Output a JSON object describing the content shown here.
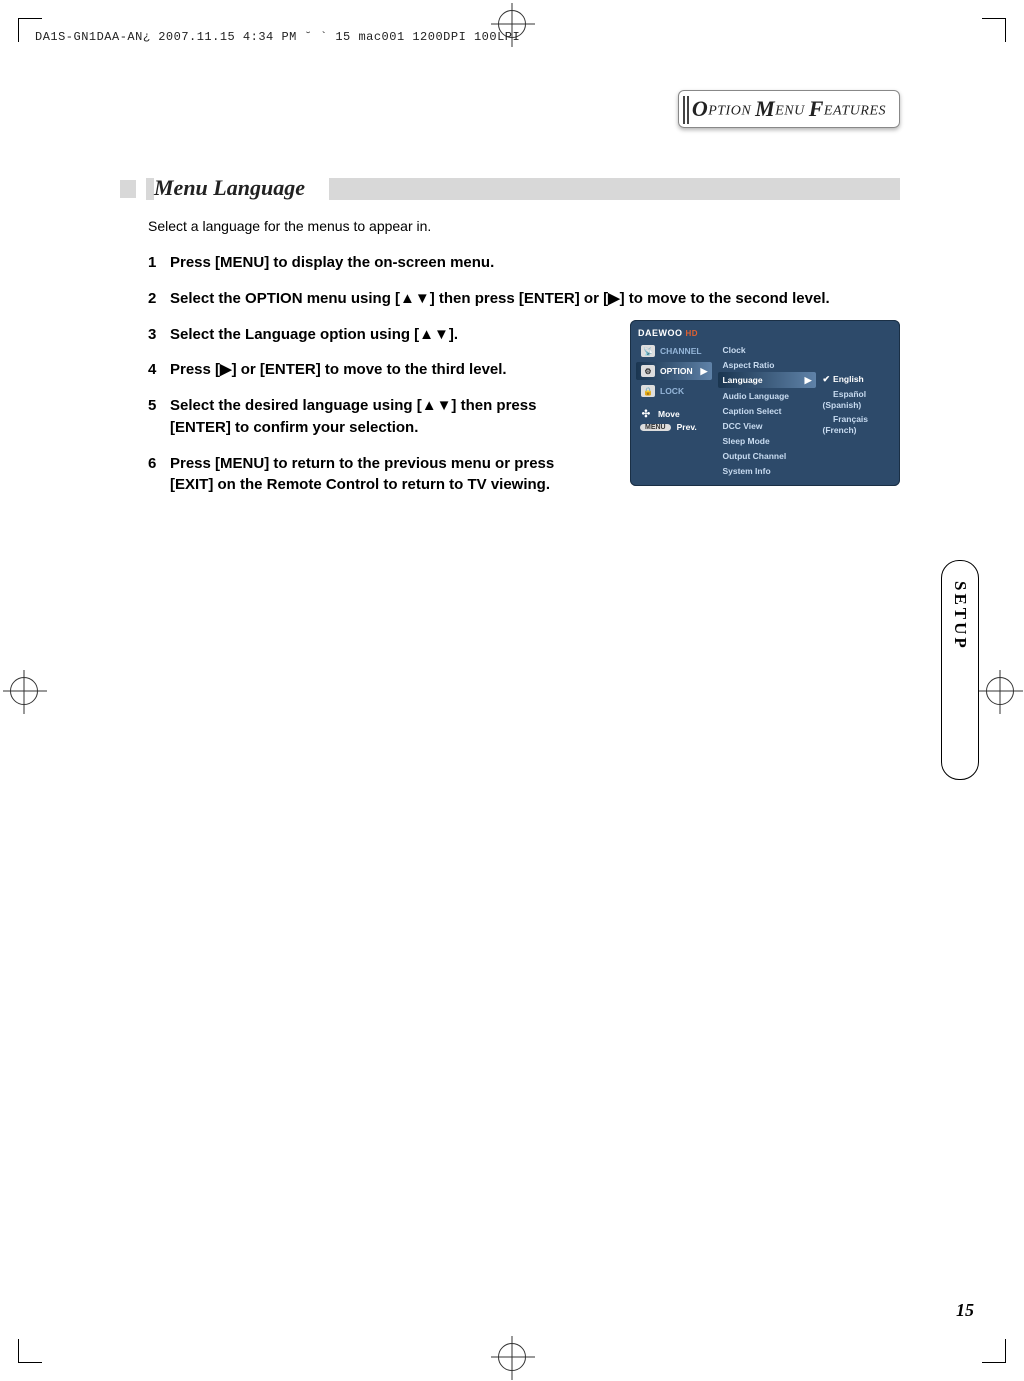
{
  "top_header": "DA1S-GN1DAA-AN¿  2007.11.15 4:34 PM  ˘ ` 15   mac001  1200DPI 100LPI",
  "header": {
    "text_parts": [
      "O",
      "PTION ",
      "M",
      "ENU ",
      "F",
      "EATURES"
    ]
  },
  "section": {
    "title": "Menu Language",
    "intro": "Select a language for the menus to appear in."
  },
  "steps": [
    {
      "n": "1",
      "text": "Press [MENU] to display the on-screen menu."
    },
    {
      "n": "2",
      "text": "Select the OPTION menu using [▲▼] then press [ENTER] or [▶] to move to the second level."
    },
    {
      "n": "3",
      "text": "Select the Language option using [▲▼]."
    },
    {
      "n": "4",
      "text": "Press [▶] or [ENTER] to move to the third level."
    },
    {
      "n": "5",
      "text": "Select the desired language using [▲▼] then press [ENTER] to confirm your  selection."
    },
    {
      "n": "6",
      "text": "Press [MENU] to return to the previous menu or press [EXIT] on the Remote Control to return to TV viewing."
    }
  ],
  "osd": {
    "logo": "DAEWOO",
    "logo_hd": "HD",
    "tabs": [
      {
        "label": "CHANNEL",
        "active": false
      },
      {
        "label": "OPTION",
        "active": true
      },
      {
        "label": "LOCK",
        "active": false
      }
    ],
    "mid": [
      {
        "label": "Clock",
        "sel": false
      },
      {
        "label": "Aspect Ratio",
        "sel": false
      },
      {
        "label": "Language",
        "sel": true
      },
      {
        "label": "Audio Language",
        "sel": false
      },
      {
        "label": "Caption Select",
        "sel": false
      },
      {
        "label": "DCC View",
        "sel": false
      },
      {
        "label": "Sleep Mode",
        "sel": false
      },
      {
        "label": "Output Channel",
        "sel": false
      },
      {
        "label": "System Info",
        "sel": false
      }
    ],
    "right": [
      {
        "label": "English",
        "checked": true
      },
      {
        "label": "Español (Spanish)",
        "checked": false
      },
      {
        "label": "Français (French)",
        "checked": false
      }
    ],
    "footer": {
      "move": "Move",
      "prev_badge": "MENU",
      "prev": "Prev."
    }
  },
  "side_tab": "SETUP",
  "page_num": "15"
}
